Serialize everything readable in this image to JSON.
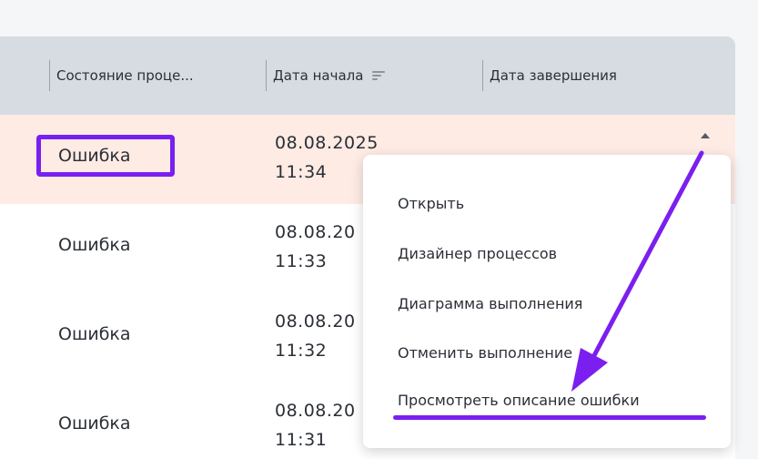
{
  "table": {
    "columns": [
      {
        "label": "Состояние проце..."
      },
      {
        "label": "Дата начала"
      },
      {
        "label": "Дата завершения"
      }
    ],
    "rows": [
      {
        "status": "Ошибка",
        "date": "08.08.2025",
        "time": "11:34"
      },
      {
        "status": "Ошибка",
        "date": "08.08.20",
        "time": "11:33"
      },
      {
        "status": "Ошибка",
        "date": "08.08.20",
        "time": "11:32"
      },
      {
        "status": "Ошибка",
        "date": "08.08.20",
        "time": "11:31"
      }
    ]
  },
  "context_menu": {
    "items": [
      {
        "label": "Открыть"
      },
      {
        "label": "Дизайнер процессов"
      },
      {
        "label": "Диаграмма выполнения"
      },
      {
        "label": "Отменить выполнение"
      },
      {
        "label": "Просмотреть описание ошибки"
      }
    ]
  },
  "annotation": {
    "color": "#7a1ff0"
  },
  "icons": {
    "sort": "sort-desc-icon",
    "caret": "caret-up-icon"
  }
}
